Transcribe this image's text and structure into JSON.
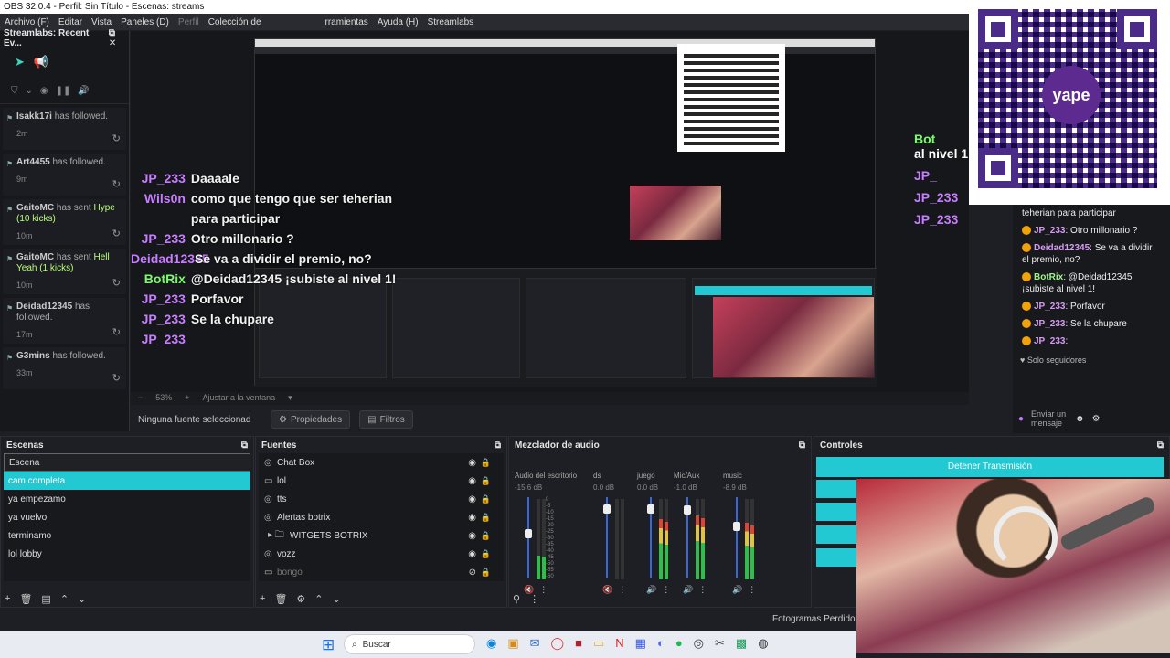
{
  "window": {
    "title": "OBS 32.0.4 - Perfil: Sin Título - Escenas: streams"
  },
  "menu": {
    "items": [
      "Archivo (F)",
      "Editar",
      "Vista",
      "Paneles (D)",
      "Perfil",
      "Colección de",
      "rramientas",
      "Ayuda (H)",
      "Streamlabs"
    ]
  },
  "streamlabs": {
    "title": "Streamlabs: Recent Ev...",
    "events": [
      {
        "name": "Isakk17i",
        "text": "has followed.",
        "extra": "",
        "age": "2m"
      },
      {
        "name": "Art4455",
        "text": "has followed.",
        "extra": "",
        "age": "9m"
      },
      {
        "name": "GaitoMC",
        "text": "has sent",
        "extra": "Hype (10 kicks)",
        "age": "10m"
      },
      {
        "name": "GaitoMC",
        "text": "has sent",
        "extra": "Hell Yeah (1 kicks)",
        "age": "10m"
      },
      {
        "name": "Deidad12345",
        "text": "has followed.",
        "extra": "",
        "age": "17m"
      },
      {
        "name": "G3mins",
        "text": "has followed.",
        "extra": "",
        "age": "33m"
      }
    ]
  },
  "overlay_chat": [
    {
      "user": "JP_233",
      "msg": "Daaaale",
      "color": "#c77dff"
    },
    {
      "user": "Wils0n",
      "msg": "como que tengo que ser teherian para participar",
      "color": "#c77dff"
    },
    {
      "user": "JP_233",
      "msg": "Otro millonario ?",
      "color": "#c77dff"
    },
    {
      "user": "Deidad12345",
      "msg": "Se va a dividir el premio, no?",
      "color": "#c77dff"
    },
    {
      "user": "BotRix",
      "msg": "@Deidad12345 ¡subiste al nivel 1!",
      "color": "#7cfc6a"
    },
    {
      "user": "JP_233",
      "msg": "Porfavor",
      "color": "#c77dff"
    },
    {
      "user": "JP_233",
      "msg": "Se la chupare",
      "color": "#c77dff"
    },
    {
      "user": "JP_233",
      "msg": "",
      "color": "#c77dff"
    }
  ],
  "right_overlay": [
    "Bot",
    "al nivel 1",
    "JP_",
    "JP_233",
    "JP_233"
  ],
  "preview_status": {
    "zoom": "53%",
    "fit": "Ajustar a la ventana"
  },
  "properties": {
    "no_source": "Ninguna fuente seleccionad",
    "props": "Propiedades",
    "filters": "Filtros"
  },
  "scenes": {
    "title": "Escenas",
    "items": [
      "Escena",
      "cam completa",
      "ya empezamo",
      "ya vuelvo",
      "terminamo",
      "lol lobby"
    ],
    "selected_index": 1
  },
  "sources": {
    "title": "Fuentes",
    "items": [
      {
        "label": "Chat Box",
        "icon": "browser-icon"
      },
      {
        "label": "lol",
        "icon": "window-icon"
      },
      {
        "label": "tts",
        "icon": "browser-icon"
      },
      {
        "label": "Alertas botrix",
        "icon": "browser-icon"
      },
      {
        "label": "WITGETS BOTRIX",
        "icon": "folder-icon"
      },
      {
        "label": "vozz",
        "icon": "browser-icon"
      },
      {
        "label": "bongo",
        "icon": "window-icon"
      }
    ]
  },
  "mixer": {
    "title": "Mezclador de audio",
    "channels": [
      {
        "name": "Audio del escritorio",
        "db": "-15.6 dB",
        "level": 0.3,
        "fader": 0.55,
        "muted": true
      },
      {
        "name": "ds",
        "db": "0.0 dB",
        "level": 0.0,
        "fader": 0.9,
        "muted": true
      },
      {
        "name": "juego",
        "db": "0.0 dB",
        "level": 0.75,
        "fader": 0.9,
        "muted": false
      },
      {
        "name": "Mic/Aux",
        "db": "-1.0 dB",
        "level": 0.8,
        "fader": 0.88,
        "muted": false
      },
      {
        "name": "music",
        "db": "-8.9 dB",
        "level": 0.7,
        "fader": 0.65,
        "muted": false
      }
    ],
    "scale": [
      "0",
      "-5",
      "-10",
      "-15",
      "-20",
      "-25",
      "-30",
      "-35",
      "-40",
      "-45",
      "-50",
      "-55",
      "-60"
    ]
  },
  "controls": {
    "title": "Controles",
    "stop_stream": "Detener Transmisión"
  },
  "frames_label": "Fotogramas Perdidos 0",
  "chat_dock": {
    "messages": [
      {
        "user": "",
        "text": "teherian para participar"
      },
      {
        "user": "JP_233",
        "text": ": Otro millonario ?"
      },
      {
        "user": "Deidad12345",
        "text": ": Se va a dividir el premio, no?"
      },
      {
        "user": "BotRix",
        "text": ": @Deidad12345 ¡subiste al nivel 1!"
      },
      {
        "user": "JP_233",
        "text": ": Porfavor"
      },
      {
        "user": "JP_233",
        "text": ": Se la chupare"
      },
      {
        "user": "JP_233",
        "text": ":"
      }
    ],
    "solo": "Solo seguidores",
    "send": "Enviar un mensaje"
  },
  "qr": {
    "brand": "yape"
  },
  "taskbar": {
    "search_placeholder": "Buscar"
  },
  "colors": {
    "accent": "#22c9d3",
    "purple": "#c77dff",
    "green": "#7cfc6a",
    "qr": "#4a2b88"
  }
}
